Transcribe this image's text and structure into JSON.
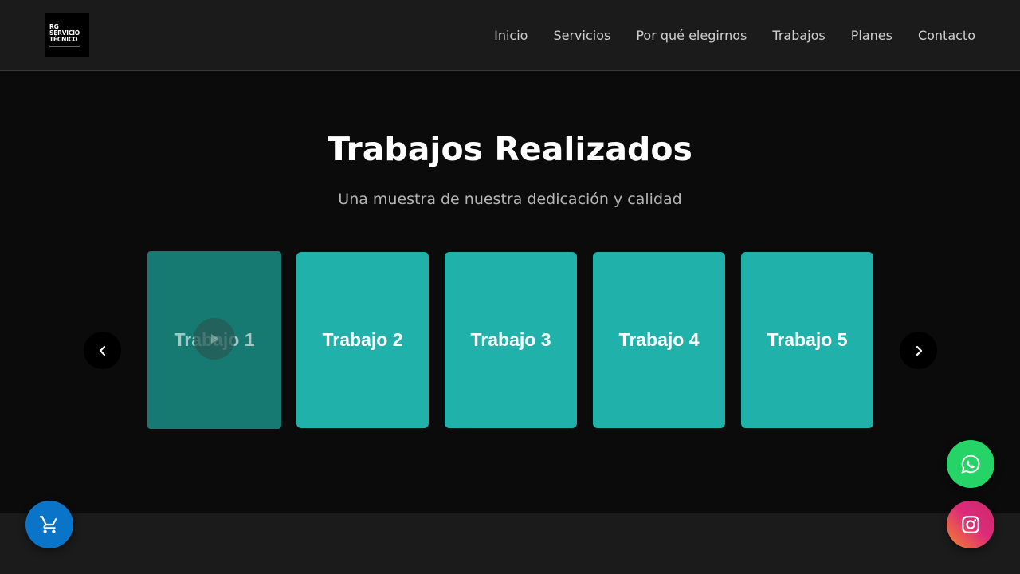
{
  "logo": {
    "line1": "RG",
    "line2": "SERVICIO",
    "line3": "TÉCNICO"
  },
  "nav": {
    "items": [
      "Inicio",
      "Servicios",
      "Por qué elegirnos",
      "Trabajos",
      "Planes",
      "Contacto"
    ]
  },
  "section": {
    "title": "Trabajos Realizados",
    "subtitle": "Una muestra de nuestra dedicación y calidad"
  },
  "carousel": {
    "cards": [
      "Trabajo 1",
      "Trabajo 2",
      "Trabajo 3",
      "Trabajo 4",
      "Trabajo 5"
    ],
    "active_index": 0,
    "prev_icon": "chevron-left-icon",
    "next_icon": "chevron-right-icon"
  },
  "floating": {
    "cart_icon": "cart-icon",
    "whatsapp_icon": "whatsapp-icon",
    "instagram_icon": "instagram-icon"
  },
  "colors": {
    "card": "#20b2aa",
    "card_active": "#167a73",
    "cart": "#0a74c9",
    "whatsapp": "#25d366"
  }
}
